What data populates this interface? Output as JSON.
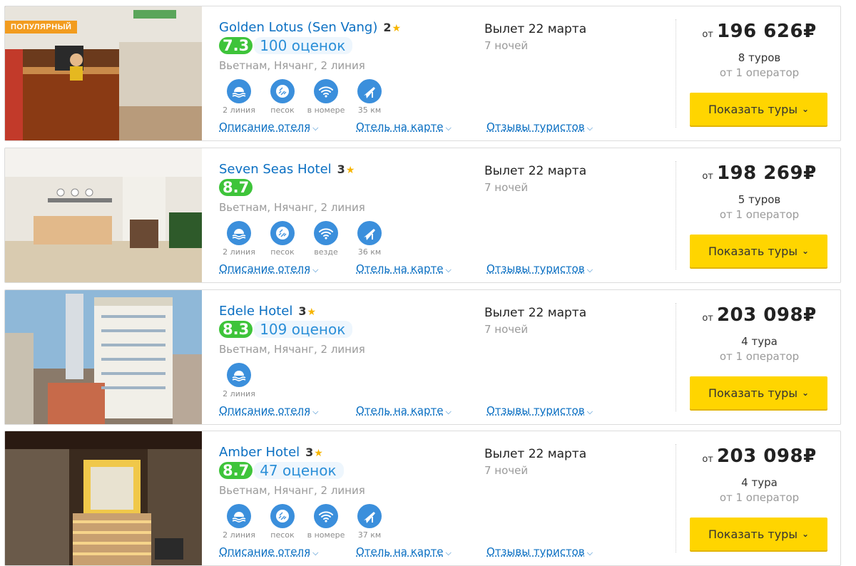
{
  "hotels": [
    {
      "badge": "популярный",
      "name": "Golden Lotus (Sen Vang)",
      "stars": "2",
      "rating": "7.3",
      "reviews": "100 оценок",
      "location": "Вьетнам, Нячанг, 2 линия",
      "amenities": [
        {
          "icon": "beach-icon",
          "label": "2 линия"
        },
        {
          "icon": "sand-icon",
          "label": "песок"
        },
        {
          "icon": "wifi-icon",
          "label": "в номере"
        },
        {
          "icon": "airport-icon",
          "label": "35 км"
        }
      ],
      "links": [
        "Описание отеля",
        "Отель на карте",
        "Отзывы туристов"
      ],
      "departure": "Вылет 22 марта",
      "nights": "7 ночей",
      "price_from": "от",
      "price": "196 626₽",
      "tours": "8 туров",
      "operators": "от 1 оператор",
      "button": "Показать туры"
    },
    {
      "badge": "",
      "name": "Seven Seas Hotel",
      "stars": "3",
      "rating": "8.7",
      "reviews": "",
      "location": "Вьетнам, Нячанг, 2 линия",
      "amenities": [
        {
          "icon": "beach-icon",
          "label": "2 линия"
        },
        {
          "icon": "sand-icon",
          "label": "песок"
        },
        {
          "icon": "wifi-icon",
          "label": "везде"
        },
        {
          "icon": "airport-icon",
          "label": "36 км"
        }
      ],
      "links": [
        "Описание отеля",
        "Отель на карте",
        "Отзывы туристов"
      ],
      "departure": "Вылет 22 марта",
      "nights": "7 ночей",
      "price_from": "от",
      "price": "198 269₽",
      "tours": "5 туров",
      "operators": "от 1 оператор",
      "button": "Показать туры"
    },
    {
      "badge": "",
      "name": "Edele Hotel",
      "stars": "3",
      "rating": "8.3",
      "reviews": "109 оценок",
      "location": "Вьетнам, Нячанг, 2 линия",
      "amenities": [
        {
          "icon": "beach-icon",
          "label": "2 линия"
        }
      ],
      "links": [
        "Описание отеля",
        "Отель на карте",
        "Отзывы туристов"
      ],
      "departure": "Вылет 22 марта",
      "nights": "7 ночей",
      "price_from": "от",
      "price": "203 098₽",
      "tours": "4 тура",
      "operators": "от 1 оператор",
      "button": "Показать туры"
    },
    {
      "badge": "",
      "name": "Amber Hotel",
      "stars": "3",
      "rating": "8.7",
      "reviews": "47 оценок",
      "location": "Вьетнам, Нячанг, 2 линия",
      "amenities": [
        {
          "icon": "beach-icon",
          "label": "2 линия"
        },
        {
          "icon": "sand-icon",
          "label": "песок"
        },
        {
          "icon": "wifi-icon",
          "label": "в номере"
        },
        {
          "icon": "airport-icon",
          "label": "37 км"
        }
      ],
      "links": [
        "Описание отеля",
        "Отель на карте",
        "Отзывы туристов"
      ],
      "departure": "Вылет 22 марта",
      "nights": "7 ночей",
      "price_from": "от",
      "price": "203 098₽",
      "tours": "4 тура",
      "operators": "от 1 оператор",
      "button": "Показать туры"
    }
  ],
  "colors": {
    "accent_blue": "#0a6fc2",
    "rating_green": "#3ec43a",
    "button_yellow": "#ffd500",
    "badge_orange": "#f29c1f",
    "icon_blue": "#3b8fdc"
  }
}
